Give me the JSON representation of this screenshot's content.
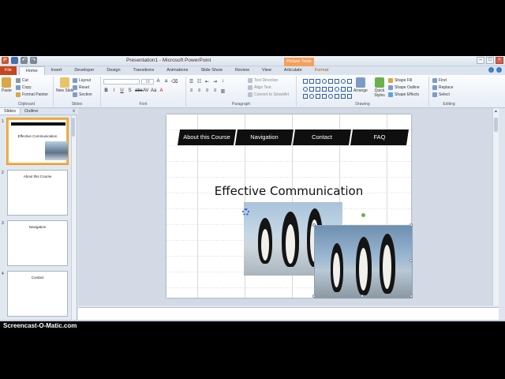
{
  "window": {
    "title": "Presentation1 - Microsoft PowerPoint",
    "context_tab": "Picture Tools"
  },
  "ribbon_tabs": [
    "File",
    "Home",
    "Insert",
    "Developer",
    "Design",
    "Transitions",
    "Animations",
    "Slide Show",
    "Review",
    "View",
    "Articulate",
    "Format"
  ],
  "ribbon": {
    "clipboard": {
      "paste": "Paste",
      "cut": "Cut",
      "copy": "Copy",
      "format_painter": "Format Painter",
      "label": "Clipboard"
    },
    "slides": {
      "new_slide": "New Slide",
      "layout": "Layout",
      "reset": "Reset",
      "section": "Section",
      "label": "Slides"
    },
    "font": {
      "label": "Font",
      "size": "18"
    },
    "paragraph": {
      "text_direction": "Text Direction",
      "align_text": "Align Text",
      "convert": "Convert to SmartArt",
      "label": "Paragraph"
    },
    "drawing": {
      "arrange": "Arrange",
      "quick_styles": "Quick Styles",
      "shape_fill": "Shape Fill",
      "shape_outline": "Shape Outline",
      "shape_effects": "Shape Effects",
      "label": "Drawing"
    },
    "editing": {
      "find": "Find",
      "replace": "Replace",
      "select": "Select",
      "label": "Editing"
    }
  },
  "panel": {
    "tabs": [
      "Slides",
      "Outline"
    ],
    "close": "x",
    "thumbnails": [
      {
        "num": "1",
        "title": "Effective Communication"
      },
      {
        "num": "2",
        "title": "About this Course"
      },
      {
        "num": "3",
        "title": "Navigation"
      },
      {
        "num": "4",
        "title": "Contact"
      }
    ]
  },
  "slide": {
    "nav": [
      "About this Course",
      "Navigation",
      "Contact",
      "FAQ"
    ],
    "title": "Effective Communication"
  },
  "watermark": "Screencast-O-Matic.com"
}
